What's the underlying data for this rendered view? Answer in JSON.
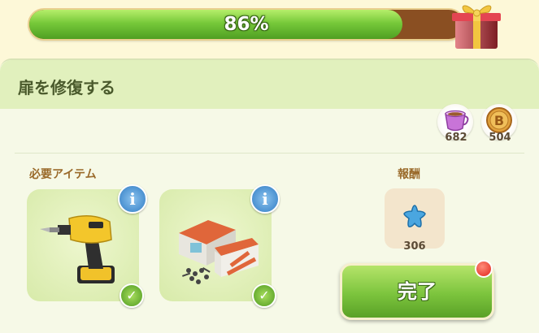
{
  "progress": {
    "value_percent": 86,
    "label": "86%"
  },
  "panel": {
    "title": "扉を修復する"
  },
  "resources": [
    {
      "icon": "cup-icon",
      "count": "682"
    },
    {
      "icon": "coin-icon",
      "count": "504"
    }
  ],
  "required": {
    "label": "必要アイテム",
    "items": [
      {
        "icon": "drill-icon",
        "completed": true
      },
      {
        "icon": "building-materials-icon",
        "completed": true
      }
    ]
  },
  "reward": {
    "label": "報酬",
    "icon": "star-icon",
    "count": "306"
  },
  "complete_button": {
    "label": "完了"
  },
  "colors": {
    "accent_green": "#7cc43d",
    "progress_track": "#8a4f22",
    "notification": "#e0271b"
  }
}
